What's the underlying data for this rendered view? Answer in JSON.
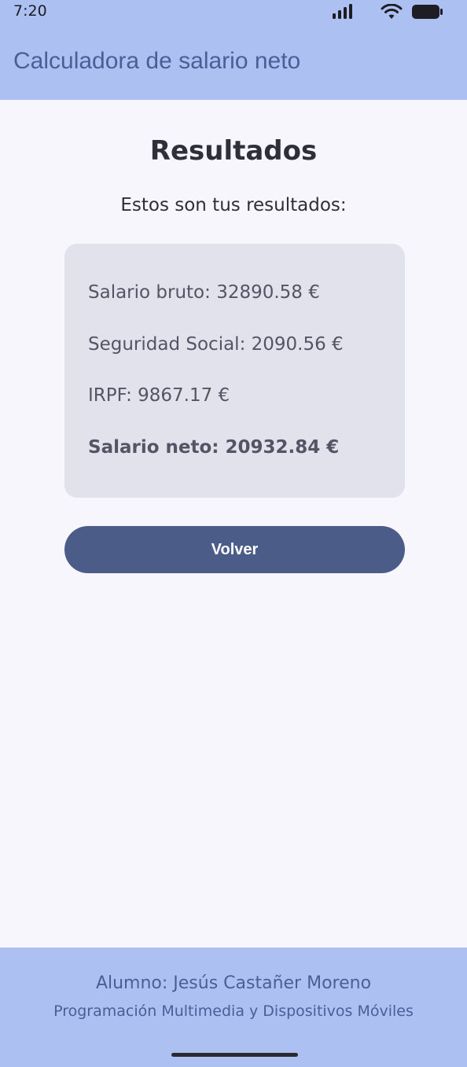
{
  "status_bar": {
    "time": "7:20",
    "icons": [
      "signal-icon",
      "wifi-icon",
      "battery-icon"
    ]
  },
  "app_bar": {
    "title": "Calculadora de salario neto"
  },
  "main": {
    "heading": "Resultados",
    "subtitle": "Estos son tus resultados:",
    "results": [
      {
        "text": "Salario bruto: 32890.58 €"
      },
      {
        "text": "Seguridad Social: 2090.56 €"
      },
      {
        "text": "IRPF: 9867.17 €"
      },
      {
        "text": "Salario neto: 20932.84 €"
      }
    ],
    "back_button_label": "Volver"
  },
  "footer": {
    "student": "Alumno: Jesús Castañer Moreno",
    "course": "Programación Multimedia y Dispositivos Móviles"
  },
  "colors": {
    "app_bar_bg": "#adc0f2",
    "page_bg": "#f8f6fd",
    "card_bg": "#e2e2ec",
    "button_bg": "#4c5c89",
    "title_color": "#4d5d96"
  }
}
